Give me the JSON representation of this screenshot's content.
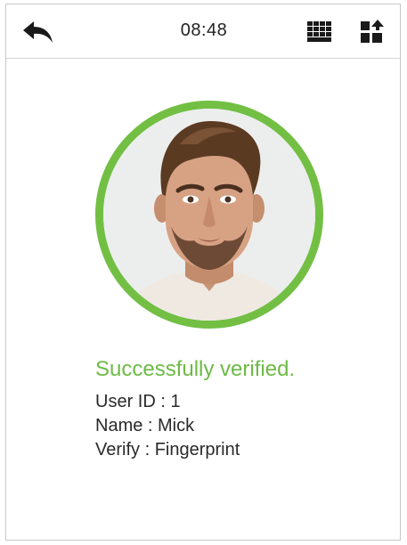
{
  "header": {
    "time": "08:48",
    "back_icon": "back-arrow-icon",
    "keypad_icon": "keypad-icon",
    "mode_icon": "verify-mode-icon"
  },
  "result": {
    "status": "Successfully verified.",
    "status_color": "#72bf44",
    "user_id_line": "User ID : 1",
    "name_line": "Name : Mick",
    "verify_line": "Verify : Fingerprint"
  }
}
